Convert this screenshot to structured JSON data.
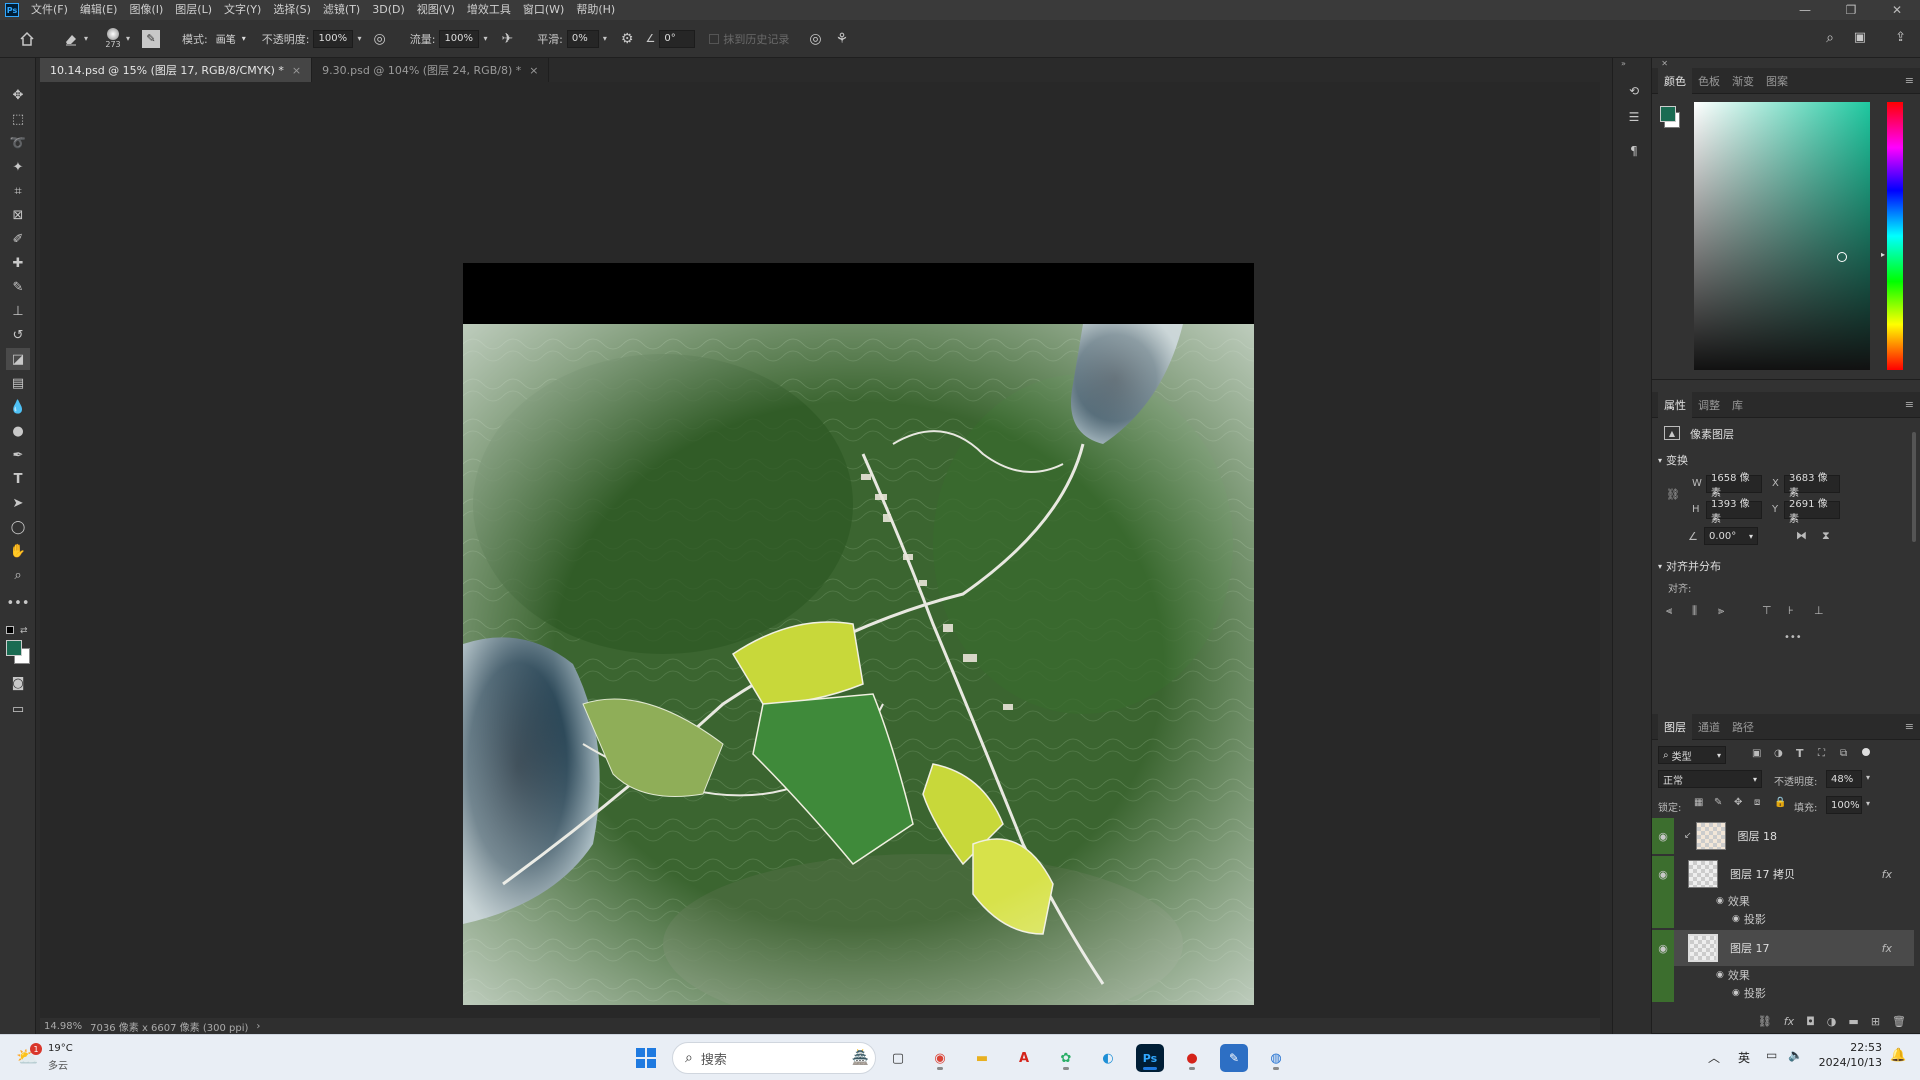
{
  "app": {
    "logo": "Ps"
  },
  "menubar": {
    "items": [
      "文件(F)",
      "编辑(E)",
      "图像(I)",
      "图层(L)",
      "文字(Y)",
      "选择(S)",
      "滤镜(T)",
      "3D(D)",
      "视图(V)",
      "增效工具",
      "窗口(W)",
      "帮助(H)"
    ],
    "window_controls": {
      "minimize": "—",
      "restore": "❐",
      "close": "✕"
    }
  },
  "options": {
    "brush_size": "273",
    "mode_label": "模式:",
    "mode_value": "画笔",
    "opacity_label": "不透明度:",
    "opacity_value": "100%",
    "flow_label": "流量:",
    "flow_value": "100%",
    "smooth_label": "平滑:",
    "smooth_value": "0%",
    "angle_value": "0°",
    "erase_history_label": "抹到历史记录"
  },
  "tabs": [
    {
      "label": "10.14.psd @ 15% (图层 17, RGB/8/CMYK) *",
      "active": true
    },
    {
      "label": "9.30.psd @ 104% (图层 24, RGB/8) *",
      "active": false
    }
  ],
  "tab_close": "×",
  "status": {
    "zoom": "14.98%",
    "doc_info": "7036 像素 x 6607 像素 (300 ppi)",
    "arrow": "›"
  },
  "color_panel": {
    "tabs": [
      "颜色",
      "色板",
      "渐变",
      "图案"
    ],
    "foreground": "#1a6b52",
    "background": "#ffffff",
    "hue_base": "#1ec8a0"
  },
  "properties_panel": {
    "tabs": [
      "属性",
      "调整",
      "库"
    ],
    "layer_type": "像素图层",
    "transform_title": "变换",
    "w_label": "W",
    "w_value": "1658 像素",
    "x_label": "X",
    "x_value": "3683 像素",
    "h_label": "H",
    "h_value": "1393 像素",
    "y_label": "Y",
    "y_value": "2691 像素",
    "angle_value": "0.00°",
    "align_title": "对齐并分布",
    "align_label": "对齐:",
    "more": "•••"
  },
  "layers_panel": {
    "tabs": [
      "图层",
      "通道",
      "路径"
    ],
    "filter_label": "类型",
    "blend_mode": "正常",
    "opacity_label": "不透明度:",
    "opacity_value": "48%",
    "lock_label": "锁定:",
    "fill_label": "填充:",
    "fill_value": "100%",
    "layers": [
      {
        "name": "图层 18",
        "fx": ""
      },
      {
        "name": "图层 17 拷贝",
        "fx": "fx"
      },
      {
        "name": "图层 17",
        "fx": "fx"
      }
    ],
    "effects_label": "效果",
    "shadow_label": "投影"
  },
  "taskbar": {
    "weather_temp": "19°C",
    "weather_desc": "多云",
    "weather_badge": "1",
    "search_placeholder": "搜索",
    "ime": "英",
    "time": "22:53",
    "date": "2024/10/13"
  }
}
